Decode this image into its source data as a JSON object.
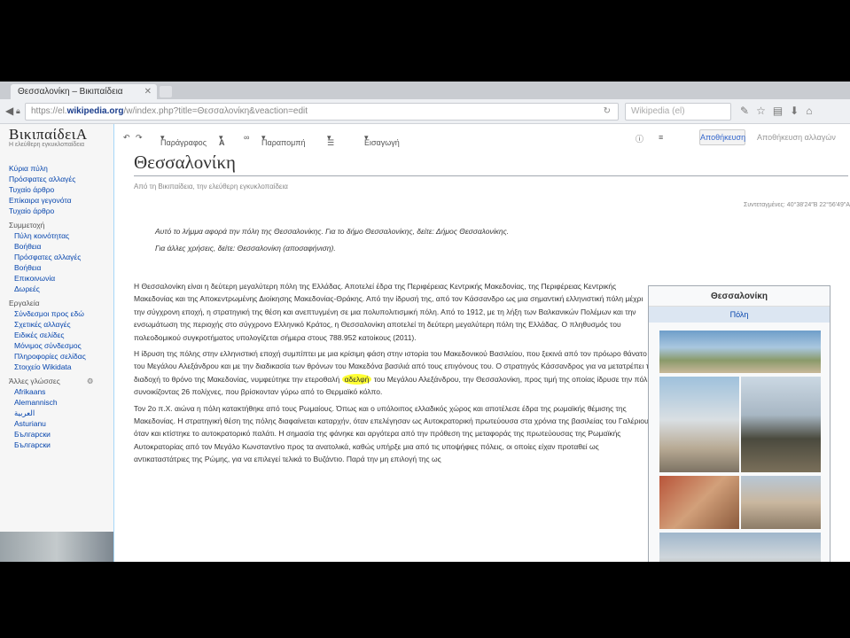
{
  "browser": {
    "tab_title": "Θεσσαλονίκη – Βικιπαίδεια",
    "url_prefix": "https://el.",
    "url_domain": "wikipedia.org",
    "url_path": "/w/index.php?title=Θεσσαλονίκη&veaction=edit",
    "search_placeholder": "Wikipedia (el)"
  },
  "sidebar": {
    "logo": "ΒικιπαίδειΑ",
    "logo_sub": "Η ελεύθερη εγκυκλοπαίδεια",
    "nav": [
      "Κύρια πύλη",
      "Πρόσφατες αλλαγές",
      "Τυχαίο άρθρο",
      "Επίκαιρα γεγονότα",
      "Τυχαίο άρθρο"
    ],
    "section_participation": "Συμμετοχή",
    "participation": [
      "Πύλη κοινότητας",
      "Βοήθεια",
      "Πρόσφατες αλλαγές",
      "Βοήθεια",
      "Επικοινωνία",
      "Δωρεές"
    ],
    "section_tools": "Εργαλεία",
    "tools": [
      "Σύνδεσμοι προς εδώ",
      "Σχετικές αλλαγές",
      "Ειδικές σελίδες",
      "Μόνιμος σύνδεσμος",
      "Πληροφορίες σελίδας",
      "Στοιχείο Wikidata"
    ],
    "section_languages": "Άλλες γλώσσες",
    "languages": [
      "Afrikaans",
      "Alemannisch",
      "العربية",
      "Asturianu",
      "Български",
      "Български"
    ]
  },
  "toolbar": {
    "paragraph": "Παράγραφος",
    "text_style": "A",
    "link": "∞",
    "cite": "Παραπομπή",
    "list": "☰",
    "insert": "Εισαγωγή",
    "save_label": "Αποθήκευση",
    "save_note": "Αποθήκευση αλλαγών"
  },
  "article": {
    "title": "Θεσσαλονίκη",
    "subtitle": "Από τη Βικιπαίδεια, την ελεύθερη εγκυκλοπαίδεια",
    "coords": "Συντεταγμένες: 40°38′24″Β 22°56′49″Α",
    "hatnote1": "Αυτό το λήμμα αφορά την πόλη της Θεσσαλονίκης. Για το δήμο Θεσσαλονίκης, δείτε: Δήμος Θεσσαλονίκης.",
    "hatnote2": "Για άλλες χρήσεις, δείτε: Θεσσαλονίκη (αποσαφήνιση).",
    "p1": "Η Θεσσαλονίκη είναι η δεύτερη μεγαλύτερη πόλη της Ελλάδας. Αποτελεί έδρα της Περιφέρειας Κεντρικής Μακεδονίας, της Περιφέρειας Κεντρικής Μακεδονίας και της Αποκεντρωμένης Διοίκησης Μακεδονίας-Θράκης. Από την ίδρυσή της, από τον Κάσσανδρο ως μια σημαντική ελληνιστική πόλη μέχρι την σύγχρονη εποχή, η στρατηγική της θέση και ανεπτυγμένη σε μια πολυπολιτισμική πόλη. Από το 1912, με τη λήξη των Βαλκανικών Πολέμων και την ενσωμάτωση της περιοχής στο σύγχρονο Ελληνικό Κράτος, η Θεσσαλονίκη αποτελεί τη δεύτερη μεγαλύτερη πόλη της Ελλάδας. Ο πληθυσμός του πολεοδομικού συγκροτήματος υπολογίζεται σήμερα στους 788.952 κατοίκους (2011).",
    "p2_a": "Η ίδρυση της πόλης στην ελληνιστική εποχή συμπίπτει με μια κρίσιμη φάση στην ιστορία του Μακεδονικού Βασιλείου, που ξεκινά από τον πρόωρο θάνατο του Μεγάλου Αλεξάνδρου και με την διαδικασία των θρόνων του Μακεδόνα βασιλιά από τους επιγόνους του. Ο στρατηγός Κάσσανδρος για να μετατρέπει τη διαδοχή το θρόνο της Μακεδονίας, νυμφεύτηκε την ετεροθαλή ",
    "p2_hl": "αδελφή",
    "p2_b": " του Μεγάλου Αλεξάνδρου, την Θεσσαλονίκη, προς τιμή της οποίας ίδρυσε την πόλη συνοικίζοντας 26 πολίχνες, που βρίσκονταν γύρω από το Θερμαϊκό κόλπο.",
    "p3": "Τον 2ο π.Χ. αιώνα η πόλη κατακτήθηκε από τους Ρωμαίους. Όπως και ο υπόλοιπος ελλαδικός χώρος και αποτέλεσε έδρα της ρωμαϊκής θέμισης της Μακεδονίας. Η στρατηγική θέση της πόλης διαφαίνεται καταρχήν, όταν επελέγησαν ως Αυτοκρατορική πρωτεύουσα στα χρόνια της βασιλείας του Γαλέριου, όταν και κτίστηκε το αυτοκρατορικό παλάτι. Η σημασία της φάνηκε και αργότερα από την πρόθεση της μεταφοράς της πρωτεύουσας της Ρωμαϊκής Αυτοκρατορίας από τον Μεγάλο Κωνσταντίνο προς τα ανατολικά, καθώς υπήρξε μια από τις υποψήφιες πόλεις, οι οποίες είχαν προταθεί ως αντικαταστάτριες της Ρώμης, για να επιλεγεί τελικά το Βυζάντιο. Παρά την μη επιλογή της ως"
  },
  "infobox": {
    "title": "Θεσσαλονίκη",
    "subtitle": "Πόλη"
  }
}
